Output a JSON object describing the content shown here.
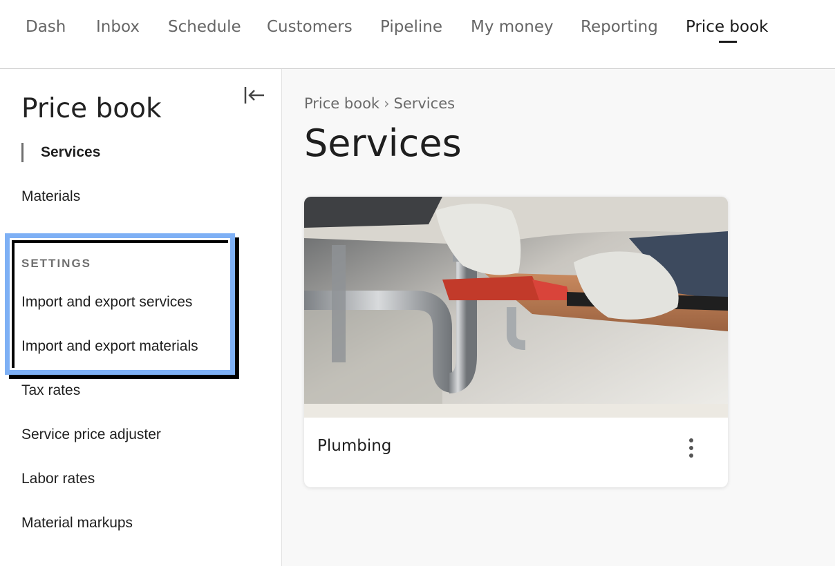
{
  "colors": {
    "highlight_border": "#7eb0f5",
    "highlight_shadow": "#000000",
    "main_background": "#f8f8f8",
    "active_text": "#1a1a1a",
    "muted_text": "#666666"
  },
  "topnav": {
    "items": [
      {
        "label": "Dash"
      },
      {
        "label": "Inbox"
      },
      {
        "label": "Schedule"
      },
      {
        "label": "Customers"
      },
      {
        "label": "Pipeline"
      },
      {
        "label": "My money"
      },
      {
        "label": "Reporting"
      },
      {
        "label": "Price book",
        "active": true
      }
    ]
  },
  "sidebar": {
    "title": "Price book",
    "collapse_icon": "collapse-left-icon",
    "items": [
      {
        "label": "Services",
        "active": true
      },
      {
        "label": "Materials"
      }
    ],
    "settings_header": "SETTINGS",
    "settings_items": [
      {
        "label": "Import and export services"
      },
      {
        "label": "Import and export materials"
      },
      {
        "label": "Tax rates"
      },
      {
        "label": "Service price adjuster"
      },
      {
        "label": "Labor rates"
      },
      {
        "label": "Material markups"
      }
    ]
  },
  "main": {
    "breadcrumb": {
      "root": "Price book",
      "separator": "›",
      "current": "Services"
    },
    "title": "Services",
    "cards": [
      {
        "label": "Plumbing",
        "image": "plumbing-photo",
        "menu_icon": "more-vertical-icon"
      }
    ]
  }
}
